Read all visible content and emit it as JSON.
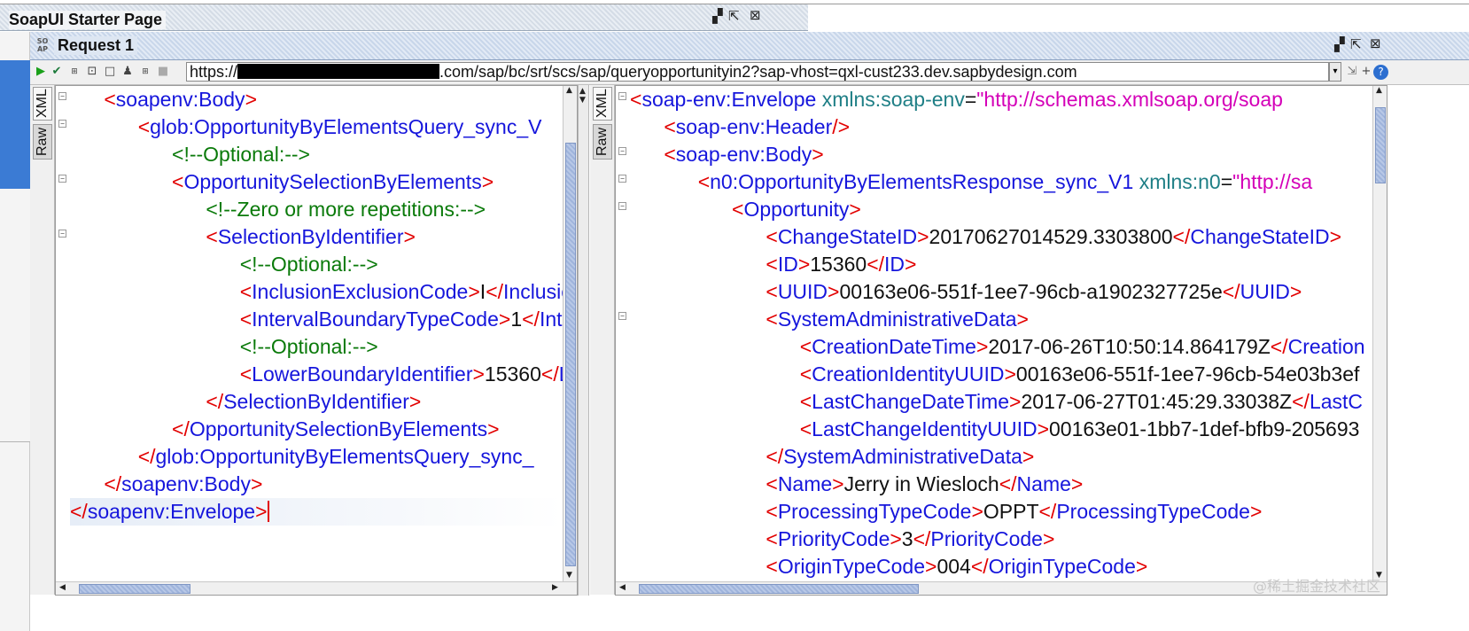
{
  "starter_tab": {
    "title": "SoapUI Starter Page",
    "ctrl_min": "▞",
    "ctrl_max": "⇱",
    "ctrl_close": "⊠"
  },
  "request_window": {
    "title": "Request 1",
    "icon_text": "SO AP",
    "ctrl_min": "▞",
    "ctrl_max": "⇱",
    "ctrl_close": "⊠"
  },
  "toolbar": {
    "url_prefix": "https://",
    "url_suffix": ".com/sap/bc/srt/scs/sap/queryopportunityin2?sap-vhost=qxl-cust233.dev.sapbydesign.com",
    "dropdown": "▾",
    "add": "+",
    "help": "?"
  },
  "request_panel": {
    "tab_xml": "XML",
    "tab_raw": "Raw",
    "lines": [
      {
        "indent": "   ",
        "parts": [
          [
            "br",
            "<"
          ],
          [
            "tag",
            "soapenv:Body"
          ],
          [
            "br",
            ">"
          ]
        ]
      },
      {
        "indent": "      ",
        "parts": [
          [
            "br",
            "<"
          ],
          [
            "tag",
            "glob:OpportunityByElementsQuery_sync_V"
          ]
        ]
      },
      {
        "indent": "         ",
        "parts": [
          [
            "cmt",
            "<!--Optional:-->"
          ]
        ]
      },
      {
        "indent": "         ",
        "parts": [
          [
            "br",
            "<"
          ],
          [
            "tag",
            "OpportunitySelectionByElements"
          ],
          [
            "br",
            ">"
          ]
        ]
      },
      {
        "indent": "            ",
        "parts": [
          [
            "cmt",
            "<!--Zero or more repetitions:-->"
          ]
        ]
      },
      {
        "indent": "            ",
        "parts": [
          [
            "br",
            "<"
          ],
          [
            "tag",
            "SelectionByIdentifier"
          ],
          [
            "br",
            ">"
          ]
        ]
      },
      {
        "indent": "               ",
        "parts": [
          [
            "cmt",
            "<!--Optional:-->"
          ]
        ]
      },
      {
        "indent": "               ",
        "parts": [
          [
            "br",
            "<"
          ],
          [
            "tag",
            "InclusionExclusionCode"
          ],
          [
            "br",
            ">"
          ],
          [
            "txt",
            "I"
          ],
          [
            "br",
            "</"
          ],
          [
            "tag",
            "Inclusion"
          ]
        ]
      },
      {
        "indent": "               ",
        "parts": [
          [
            "br",
            "<"
          ],
          [
            "tag",
            "IntervalBoundaryTypeCode"
          ],
          [
            "br",
            ">"
          ],
          [
            "txt",
            "1"
          ],
          [
            "br",
            "</"
          ],
          [
            "tag",
            "Interv"
          ]
        ]
      },
      {
        "indent": "               ",
        "parts": [
          [
            "cmt",
            "<!--Optional:-->"
          ]
        ]
      },
      {
        "indent": "               ",
        "parts": [
          [
            "br",
            "<"
          ],
          [
            "tag",
            "LowerBoundaryIdentifier"
          ],
          [
            "br",
            ">"
          ],
          [
            "txt",
            "15360"
          ],
          [
            "br",
            "</"
          ],
          [
            "tag",
            "Lov"
          ]
        ]
      },
      {
        "indent": "            ",
        "parts": [
          [
            "br",
            "</"
          ],
          [
            "tag",
            "SelectionByIdentifier"
          ],
          [
            "br",
            ">"
          ]
        ]
      },
      {
        "indent": "         ",
        "parts": [
          [
            "br",
            "</"
          ],
          [
            "tag",
            "OpportunitySelectionByElements"
          ],
          [
            "br",
            ">"
          ]
        ]
      },
      {
        "indent": "      ",
        "parts": [
          [
            "br",
            "</"
          ],
          [
            "tag",
            "glob:OpportunityByElementsQuery_sync_"
          ]
        ]
      },
      {
        "indent": "   ",
        "parts": [
          [
            "br",
            "</"
          ],
          [
            "tag",
            "soapenv:Body"
          ],
          [
            "br",
            ">"
          ]
        ]
      },
      {
        "indent": "",
        "parts": [
          [
            "br",
            "</"
          ],
          [
            "tag",
            "soapenv:Envelope"
          ],
          [
            "br",
            ">"
          ]
        ]
      }
    ]
  },
  "response_panel": {
    "tab_xml": "XML",
    "tab_raw": "Raw",
    "lines": [
      {
        "indent": "",
        "parts": [
          [
            "br",
            "<"
          ],
          [
            "tag",
            "soap-env:Envelope"
          ],
          [
            "txt",
            " "
          ],
          [
            "attr",
            "xmlns:soap-env"
          ],
          [
            "eq",
            "="
          ],
          [
            "val",
            "\"http://schemas.xmlsoap.org/soap"
          ]
        ]
      },
      {
        "indent": "   ",
        "parts": [
          [
            "br",
            "<"
          ],
          [
            "tag",
            "soap-env:Header"
          ],
          [
            "br",
            "/>"
          ]
        ]
      },
      {
        "indent": "   ",
        "parts": [
          [
            "br",
            "<"
          ],
          [
            "tag",
            "soap-env:Body"
          ],
          [
            "br",
            ">"
          ]
        ]
      },
      {
        "indent": "      ",
        "parts": [
          [
            "br",
            "<"
          ],
          [
            "tag",
            "n0:OpportunityByElementsResponse_sync_V1"
          ],
          [
            "txt",
            " "
          ],
          [
            "attr",
            "xmlns:n0"
          ],
          [
            "eq",
            "="
          ],
          [
            "val",
            "\"http://sa"
          ]
        ]
      },
      {
        "indent": "         ",
        "parts": [
          [
            "br",
            "<"
          ],
          [
            "tag",
            "Opportunity"
          ],
          [
            "br",
            ">"
          ]
        ]
      },
      {
        "indent": "            ",
        "parts": [
          [
            "br",
            "<"
          ],
          [
            "tag",
            "ChangeStateID"
          ],
          [
            "br",
            ">"
          ],
          [
            "txt",
            "20170627014529.3303800"
          ],
          [
            "br",
            "</"
          ],
          [
            "tag",
            "ChangeStateID"
          ],
          [
            "br",
            ">"
          ]
        ]
      },
      {
        "indent": "            ",
        "parts": [
          [
            "br",
            "<"
          ],
          [
            "tag",
            "ID"
          ],
          [
            "br",
            ">"
          ],
          [
            "txt",
            "15360"
          ],
          [
            "br",
            "</"
          ],
          [
            "tag",
            "ID"
          ],
          [
            "br",
            ">"
          ]
        ]
      },
      {
        "indent": "            ",
        "parts": [
          [
            "br",
            "<"
          ],
          [
            "tag",
            "UUID"
          ],
          [
            "br",
            ">"
          ],
          [
            "txt",
            "00163e06-551f-1ee7-96cb-a1902327725e"
          ],
          [
            "br",
            "</"
          ],
          [
            "tag",
            "UUID"
          ],
          [
            "br",
            ">"
          ]
        ]
      },
      {
        "indent": "            ",
        "parts": [
          [
            "br",
            "<"
          ],
          [
            "tag",
            "SystemAdministrativeData"
          ],
          [
            "br",
            ">"
          ]
        ]
      },
      {
        "indent": "               ",
        "parts": [
          [
            "br",
            "<"
          ],
          [
            "tag",
            "CreationDateTime"
          ],
          [
            "br",
            ">"
          ],
          [
            "txt",
            "2017-06-26T10:50:14.864179Z"
          ],
          [
            "br",
            "</"
          ],
          [
            "tag",
            "Creation"
          ]
        ]
      },
      {
        "indent": "               ",
        "parts": [
          [
            "br",
            "<"
          ],
          [
            "tag",
            "CreationIdentityUUID"
          ],
          [
            "br",
            ">"
          ],
          [
            "txt",
            "00163e06-551f-1ee7-96cb-54e03b3ef"
          ]
        ]
      },
      {
        "indent": "               ",
        "parts": [
          [
            "br",
            "<"
          ],
          [
            "tag",
            "LastChangeDateTime"
          ],
          [
            "br",
            ">"
          ],
          [
            "txt",
            "2017-06-27T01:45:29.33038Z"
          ],
          [
            "br",
            "</"
          ],
          [
            "tag",
            "LastC"
          ]
        ]
      },
      {
        "indent": "               ",
        "parts": [
          [
            "br",
            "<"
          ],
          [
            "tag",
            "LastChangeIdentityUUID"
          ],
          [
            "br",
            ">"
          ],
          [
            "txt",
            "00163e01-1bb7-1def-bfb9-205693"
          ]
        ]
      },
      {
        "indent": "            ",
        "parts": [
          [
            "br",
            "</"
          ],
          [
            "tag",
            "SystemAdministrativeData"
          ],
          [
            "br",
            ">"
          ]
        ]
      },
      {
        "indent": "            ",
        "parts": [
          [
            "br",
            "<"
          ],
          [
            "tag",
            "Name"
          ],
          [
            "br",
            ">"
          ],
          [
            "txt",
            "Jerry in Wiesloch"
          ],
          [
            "br",
            "</"
          ],
          [
            "tag",
            "Name"
          ],
          [
            "br",
            ">"
          ]
        ]
      },
      {
        "indent": "            ",
        "parts": [
          [
            "br",
            "<"
          ],
          [
            "tag",
            "ProcessingTypeCode"
          ],
          [
            "br",
            ">"
          ],
          [
            "txt",
            "OPPT"
          ],
          [
            "br",
            "</"
          ],
          [
            "tag",
            "ProcessingTypeCode"
          ],
          [
            "br",
            ">"
          ]
        ]
      },
      {
        "indent": "            ",
        "parts": [
          [
            "br",
            "<"
          ],
          [
            "tag",
            "PriorityCode"
          ],
          [
            "br",
            ">"
          ],
          [
            "txt",
            "3"
          ],
          [
            "br",
            "</"
          ],
          [
            "tag",
            "PriorityCode"
          ],
          [
            "br",
            ">"
          ]
        ]
      },
      {
        "indent": "            ",
        "parts": [
          [
            "br",
            "<"
          ],
          [
            "tag",
            "OriginTypeCode"
          ],
          [
            "br",
            ">"
          ],
          [
            "txt",
            "004"
          ],
          [
            "br",
            "</"
          ],
          [
            "tag",
            "OriginTypeCode"
          ],
          [
            "br",
            ">"
          ]
        ]
      }
    ]
  },
  "watermark": "@稀土掘金技术社区",
  "colors": {
    "tag": "#1616dc",
    "bracket": "#e20000",
    "comment": "#0a7a0a",
    "attr": "#1f7f86",
    "value": "#d400b8"
  }
}
